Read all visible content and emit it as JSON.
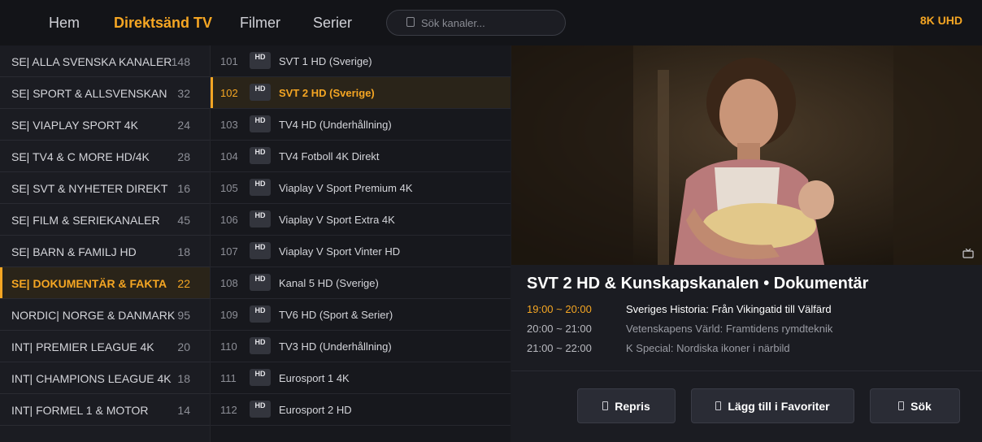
{
  "nav": {
    "items": [
      "Hem",
      "Direktsänd TV",
      "Filmer",
      "Serier"
    ],
    "active_index": 1
  },
  "search": {
    "placeholder": "Sök kanaler..."
  },
  "quality_badge": "8K UHD",
  "categories": [
    {
      "name": "SE| ALLA SVENSKA KANALER",
      "count": "148"
    },
    {
      "name": "SE| SPORT & ALLSVENSKAN",
      "count": "32"
    },
    {
      "name": "SE| VIAPLAY SPORT 4K",
      "count": "24"
    },
    {
      "name": "SE| TV4 & C MORE HD/4K",
      "count": "28"
    },
    {
      "name": "SE| SVT & NYHETER DIREKT",
      "count": "16"
    },
    {
      "name": "SE| FILM & SERIEKANALER",
      "count": "45"
    },
    {
      "name": "SE| BARN & FAMILJ HD",
      "count": "18"
    },
    {
      "name": "SE| DOKUMENTÄR & FAKTA",
      "count": "22"
    },
    {
      "name": "NORDIC| NORGE & DANMARK",
      "count": "95"
    },
    {
      "name": "INT| PREMIER LEAGUE 4K",
      "count": "20"
    },
    {
      "name": "INT| CHAMPIONS LEAGUE 4K",
      "count": "18"
    },
    {
      "name": "INT| FORMEL 1 & MOTOR",
      "count": "14"
    }
  ],
  "active_category_index": 7,
  "channels": [
    {
      "number": "101",
      "badge": "HD",
      "name": "SVT 1 HD (Sverige)"
    },
    {
      "number": "102",
      "badge": "HD",
      "name": "SVT 2 HD (Sverige)"
    },
    {
      "number": "103",
      "badge": "HD",
      "name": "TV4 HD (Underhållning)"
    },
    {
      "number": "104",
      "badge": "HD",
      "name": "TV4 Fotboll 4K Direkt"
    },
    {
      "number": "105",
      "badge": "HD",
      "name": "Viaplay V Sport Premium 4K"
    },
    {
      "number": "106",
      "badge": "HD",
      "name": "Viaplay V Sport Extra 4K"
    },
    {
      "number": "107",
      "badge": "HD",
      "name": "Viaplay V Sport Vinter HD"
    },
    {
      "number": "108",
      "badge": "HD",
      "name": "Kanal 5 HD (Sverige)"
    },
    {
      "number": "109",
      "badge": "HD",
      "name": "TV6 HD (Sport & Serier)"
    },
    {
      "number": "110",
      "badge": "HD",
      "name": "TV3 HD (Underhållning)"
    },
    {
      "number": "111",
      "badge": "HD",
      "name": "Eurosport 1 4K"
    },
    {
      "number": "112",
      "badge": "HD",
      "name": "Eurosport 2 HD"
    }
  ],
  "active_channel_index": 1,
  "info": {
    "title": "SVT 2 HD & Kunskapskanalen  •  Dokumentär",
    "epg": [
      {
        "time": "19:00 ~ 20:00",
        "title": "Sveriges Historia: Från Vikingatid till Välfärd"
      },
      {
        "time": "20:00 ~ 21:00",
        "title": "Vetenskapens Värld: Framtidens rymdteknik"
      },
      {
        "time": "21:00 ~ 22:00",
        "title": "K Special: Nordiska ikoner i närbild"
      }
    ],
    "current_index": 0
  },
  "buttons": {
    "repris": "Repris",
    "favorites": "Lägg till i Favoriter",
    "search": "Sök"
  },
  "colors": {
    "accent": "#f5a623",
    "background": "#1b1c22",
    "topbar": "#131418"
  }
}
